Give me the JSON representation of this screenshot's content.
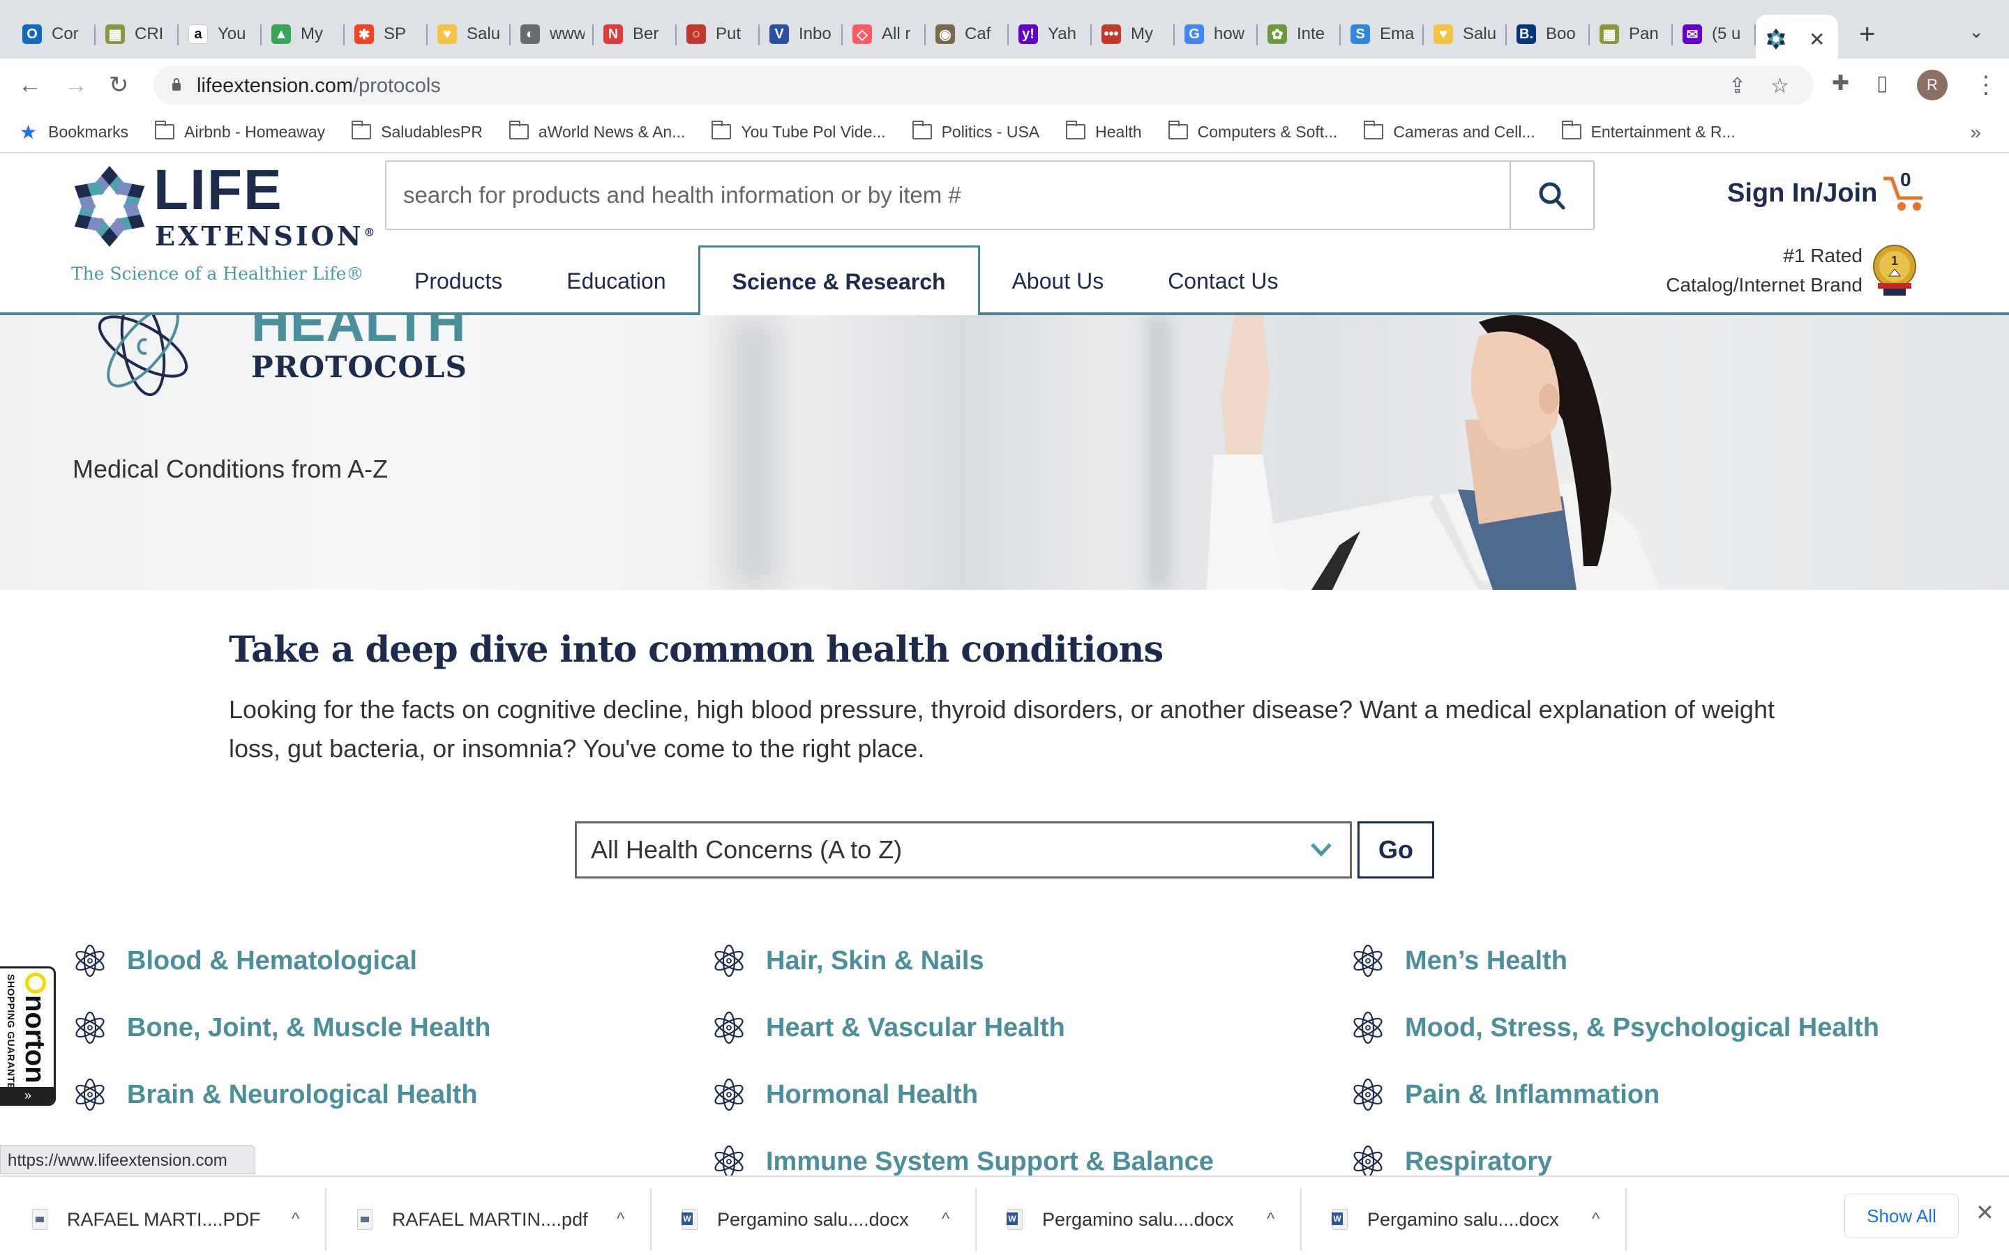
{
  "browser": {
    "tabs": [
      {
        "title": "Cor",
        "icon": "outlook-icon",
        "color": "#0f6cbd",
        "glyph": "O"
      },
      {
        "title": "CRI",
        "icon": "crm-icon",
        "color": "#8a9a3a",
        "glyph": "▦"
      },
      {
        "title": "You",
        "icon": "amazon-icon",
        "color": "#ffffff",
        "glyph": "a"
      },
      {
        "title": "My",
        "icon": "google-drive-icon",
        "color": "#34a853",
        "glyph": "▲"
      },
      {
        "title": "SP",
        "icon": "joomla-icon",
        "color": "#f44321",
        "glyph": "✱"
      },
      {
        "title": "Salu",
        "icon": "saludables-icon",
        "color": "#f5c342",
        "glyph": "♥"
      },
      {
        "title": "www",
        "icon": "globe-icon",
        "color": "#6b6b6b",
        "glyph": "◐"
      },
      {
        "title": "Ber",
        "icon": "newsmax-icon",
        "color": "#e53935",
        "glyph": "N"
      },
      {
        "title": "Put",
        "icon": "speech-bubble-icon",
        "color": "#c0392b",
        "glyph": "○"
      },
      {
        "title": "Inbo",
        "icon": "v-icon",
        "color": "#2851a3",
        "glyph": "V"
      },
      {
        "title": "All r",
        "icon": "airbnb-icon",
        "color": "#ff5a5f",
        "glyph": "◇"
      },
      {
        "title": "Caf",
        "icon": "coffee-icon",
        "color": "#7a6a4a",
        "glyph": "◉"
      },
      {
        "title": "Yah",
        "icon": "yahoo-icon",
        "color": "#6001d2",
        "glyph": "y!"
      },
      {
        "title": "My",
        "icon": "lastpass-icon",
        "color": "#c0392b",
        "glyph": "•••"
      },
      {
        "title": "how",
        "icon": "google-icon",
        "color": "#4285f4",
        "glyph": "G"
      },
      {
        "title": "Inte",
        "icon": "plant-icon",
        "color": "#6a9a3a",
        "glyph": "✿"
      },
      {
        "title": "Ema",
        "icon": "sendinblue-icon",
        "color": "#2e86de",
        "glyph": "S"
      },
      {
        "title": "Salu",
        "icon": "saludables-icon",
        "color": "#f5c342",
        "glyph": "♥"
      },
      {
        "title": "Boo",
        "icon": "booking-icon",
        "color": "#003580",
        "glyph": "B."
      },
      {
        "title": "Pan",
        "icon": "crm-icon",
        "color": "#8a9a3a",
        "glyph": "▦"
      },
      {
        "title": "(5 u",
        "icon": "yahoo-mail-icon",
        "color": "#6001d2",
        "glyph": "✉"
      }
    ],
    "active_tab": {
      "title": "",
      "icon": "life-extension-icon"
    },
    "new_tab": "+",
    "tab_menu": "⌄",
    "url_domain": "lifeextension.com",
    "url_path": "/protocols",
    "avatar_initial": "R",
    "bookmarks_label": "Bookmarks",
    "bookmarks": [
      "Airbnb - Homeaway",
      "SaludablesPR",
      "aWorld News & An...",
      "You Tube Pol Vide...",
      "Politics - USA",
      "Health",
      "Computers & Soft...",
      "Cameras and Cell...",
      "Entertainment & R..."
    ],
    "bookmarks_more": "»",
    "status_url": "https://www.lifeextension.com"
  },
  "site": {
    "logo": {
      "life": "LIFE",
      "extension": "EXTENSION",
      "reg": "®",
      "tagline": "The Science of a Healthier Life®"
    },
    "search_placeholder": "search for products and health information or by item #",
    "sign_in": "Sign In/Join",
    "cart_count": "0",
    "nav": [
      "Products",
      "Education",
      "Science & Research",
      "About Us",
      "Contact Us"
    ],
    "active_nav": "Science & Research",
    "rated_line1": "#1 Rated",
    "rated_line2": "Catalog/Internet Brand",
    "colors": {
      "navy": "#1d2b4f",
      "teal": "#4a8f9c",
      "cart": "#e8732a"
    }
  },
  "hero": {
    "title_top": "HEALTH",
    "title_bottom": "PROTOCOLS",
    "subtitle": "Medical Conditions from A-Z"
  },
  "intro": {
    "title": "Take a deep dive into common health conditions",
    "text": "Looking for the facts on cognitive decline, high blood pressure, thyroid disorders, or another disease? Want a medical explanation of weight loss, gut bacteria, or insomnia? You've come to the right place."
  },
  "filter": {
    "selected": "All Health Concerns (A to Z)",
    "go_label": "Go"
  },
  "categories": {
    "col1": [
      "Blood & Hematological",
      "Bone, Joint, & Muscle Health",
      "Brain & Neurological Health"
    ],
    "col2": [
      "Hair, Skin & Nails",
      "Heart & Vascular Health",
      "Hormonal Health",
      "Immune System Support & Balance"
    ],
    "col3": [
      "Men’s Health",
      "Mood, Stress, & Psychological Health",
      "Pain & Inflammation",
      "Respiratory"
    ]
  },
  "norton": {
    "word": "norton",
    "tagline": "SHOPPING GUARANTEE",
    "expand": "»"
  },
  "downloads": {
    "items": [
      {
        "name": "RAFAEL MARTI....PDF",
        "type": "pdf"
      },
      {
        "name": "RAFAEL MARTIN....pdf",
        "type": "pdf"
      },
      {
        "name": "Pergamino salu....docx",
        "type": "doc"
      },
      {
        "name": "Pergamino salu....docx",
        "type": "doc"
      },
      {
        "name": "Pergamino salu....docx",
        "type": "doc"
      }
    ],
    "caret": "^",
    "show_all": "Show All",
    "close": "✕"
  }
}
